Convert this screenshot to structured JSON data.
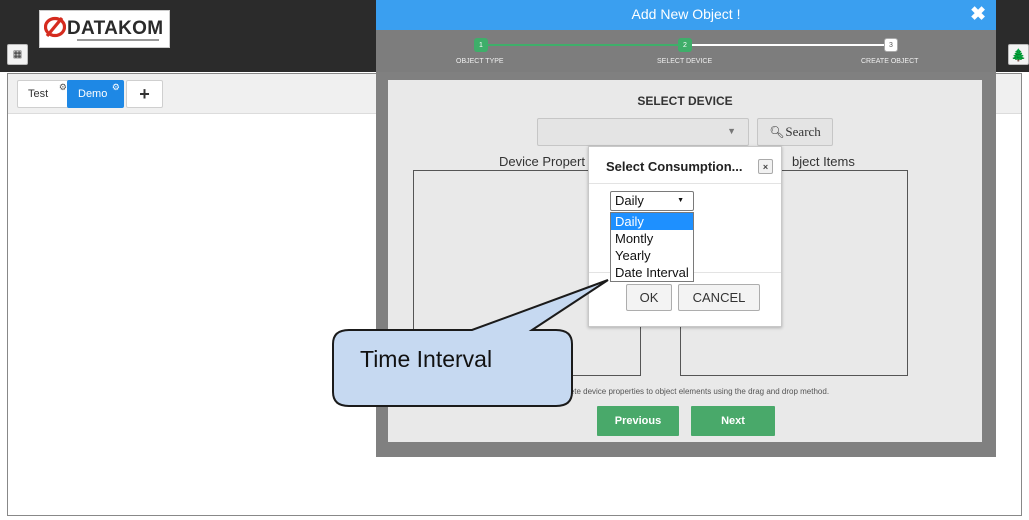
{
  "header": {
    "logo_text": "DATAKOM",
    "logo_subtext": "DATAKOM ELECTRONIC ENGINEERING LTD. STI."
  },
  "tabs": [
    {
      "label": "Test"
    },
    {
      "label": "Demo"
    }
  ],
  "tab_add_label": "+",
  "modal": {
    "title": "Add New Object !",
    "close_label": "✖",
    "steps": [
      {
        "number": "1",
        "label": "OBJECT TYPE"
      },
      {
        "number": "2",
        "label": "SELECT DEVICE"
      },
      {
        "number": "3",
        "label": "CREATE OBJECT"
      }
    ],
    "section_title": "SELECT DEVICE",
    "device_select_value": "",
    "search_label": "Search",
    "left_column_header": "Device Propert",
    "right_column_header": "bject Items",
    "info_text": "lete device properties to object elements using the drag and drop method.",
    "previous_label": "Previous",
    "next_label": "Next"
  },
  "popup": {
    "title": "Select Consumption...",
    "close_label": "×",
    "selected_value": "Daily",
    "options": [
      "Daily",
      "Montly",
      "Yearly",
      "Date Interval"
    ],
    "highlighted_option": "Daily",
    "ok_label": "OK",
    "cancel_label": "CANCEL"
  },
  "callout": {
    "text": "Time Interval"
  },
  "colors": {
    "header_bg": "#2b2b2b",
    "modal_header": "#3a9ff0",
    "step_done": "#3fae6a",
    "button_green": "#49a96a",
    "tab_active": "#1e88e5",
    "callout_fill": "#c6d9f1"
  },
  "icons": {
    "apps": "grid-icon",
    "tree": "tree-icon",
    "search": "search-icon",
    "gear": "gear-icon"
  }
}
